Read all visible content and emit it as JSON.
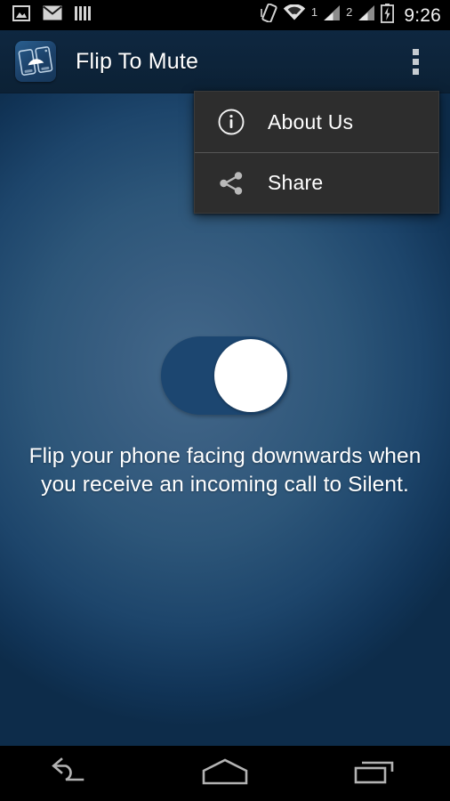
{
  "status_bar": {
    "left_icons": [
      {
        "name": "gallery-image-icon"
      },
      {
        "name": "mail-envelope-icon"
      },
      {
        "name": "vertical-bars-icon"
      }
    ],
    "right_icons": [
      {
        "name": "vibrate-tilt-phone-icon"
      },
      {
        "name": "wifi-icon"
      },
      {
        "name": "sim1-signal-icon",
        "label": "1"
      },
      {
        "name": "sim2-signal-icon",
        "label": "2"
      },
      {
        "name": "battery-charging-icon"
      }
    ],
    "time": "9:26"
  },
  "action_bar": {
    "app_icon": "flip-to-mute-app-icon",
    "title": "Flip To Mute",
    "overflow_icon": "overflow-menu-icon"
  },
  "overflow_menu": {
    "visible": true,
    "items": [
      {
        "icon": "info-circle-icon",
        "label": "About Us"
      },
      {
        "icon": "share-icon",
        "label": "Share"
      }
    ]
  },
  "main": {
    "toggle": {
      "name": "flip-to-mute-toggle",
      "state": "on",
      "track_color": "#1c4670",
      "thumb_color": "#ffffff"
    },
    "hint_text": "Flip your phone facing downwards when you receive an incoming call to Silent.",
    "background_center_color": "#43688a",
    "background_edge_color": "#0d2c4a"
  },
  "nav_bar": {
    "buttons": [
      {
        "name": "back-button",
        "icon": "back-arrow-icon"
      },
      {
        "name": "home-button",
        "icon": "home-icon"
      },
      {
        "name": "recents-button",
        "icon": "recents-icon"
      }
    ]
  }
}
